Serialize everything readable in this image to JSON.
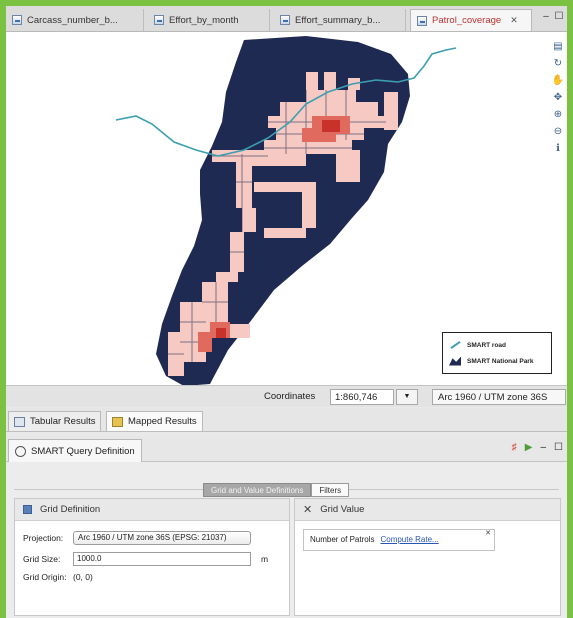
{
  "editor_tabs": [
    {
      "label": "Carcass_number_b..."
    },
    {
      "label": "Effort_by_month"
    },
    {
      "label": "Effort_summary_b..."
    },
    {
      "label": "Patrol_coverage",
      "close": "✕"
    }
  ],
  "map": {
    "legend": {
      "items": [
        {
          "label": "SMART road",
          "icon": "road-icon"
        },
        {
          "label": "SMART National Park",
          "icon": "area-icon"
        }
      ]
    },
    "tools": [
      "layers-icon",
      "refresh-icon",
      "pan-icon",
      "move-icon",
      "zoom-in-icon",
      "zoom-out-icon",
      "info-icon"
    ],
    "colors": {
      "park": "#1f2a52",
      "coverage_light": "#f6c9c2",
      "coverage_dark": "#e0524a",
      "road": "#3d9fb0"
    }
  },
  "coordinates": {
    "label": "Coordinates",
    "scale": "1:860,746",
    "dropdown": "▼",
    "crs": "Arc 1960 / UTM zone 36S"
  },
  "result_tabs": [
    {
      "label": "Tabular Results"
    },
    {
      "label": "Mapped Results"
    }
  ],
  "query": {
    "title": "SMART Query Definition",
    "subtabs": [
      "Grid and Value Definitions",
      "Filters"
    ],
    "grid": {
      "title": "Grid Definition",
      "projection_label": "Projection:",
      "projection_value": "Arc 1960 / UTM zone 36S (EPSG: 21037)",
      "size_label": "Grid Size:",
      "size_value": "1000.0",
      "size_unit": "m",
      "origin_label": "Grid Origin:",
      "origin_value": "(0, 0)"
    },
    "value": {
      "title": "Grid Value",
      "item_label": "Number of Patrols",
      "item_link": "Compute Rate..."
    }
  }
}
